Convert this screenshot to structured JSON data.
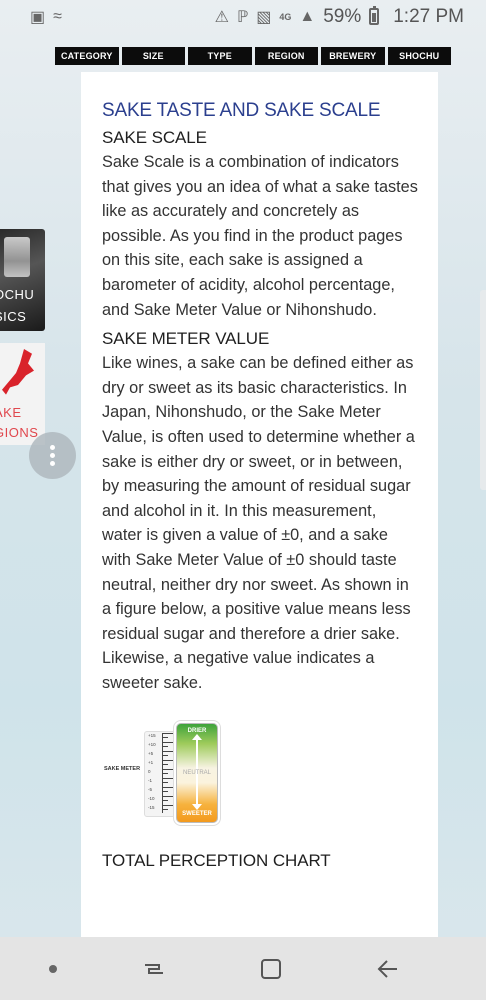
{
  "status_bar": {
    "battery_percent": "59%",
    "time": "1:27 PM",
    "network": "4G"
  },
  "nav": {
    "tabs": [
      {
        "label": "CATEGORY"
      },
      {
        "label": "SIZE"
      },
      {
        "label": "TYPE"
      },
      {
        "label": "REGION"
      },
      {
        "label": "BREWERY"
      },
      {
        "label": "SHOCHU"
      }
    ]
  },
  "side": {
    "thumb1_text": [
      "OCHU",
      "SICS"
    ],
    "thumb2_text": [
      "AKE",
      "GIONS"
    ]
  },
  "article": {
    "title": "SAKE TASTE AND SAKE SCALE",
    "sections": [
      {
        "heading": "SAKE SCALE",
        "body": "Sake Scale is a combination of indicators that gives you an idea of what a sake tastes like as accurately and concretely as possible. As you find in the product pages on this site, each sake is assigned a barometer of acidity, alcohol percentage, and Sake Meter Value or Nihonshudo."
      },
      {
        "heading": "SAKE METER VALUE",
        "body": "Like wines, a sake can be defined either as dry or sweet as its basic characteristics. In Japan, Nihonshudo, or the Sake Meter Value, is often used to determine whether a sake is either dry or sweet, or in between, by measuring the amount of residual sugar and alcohol in it. In this measurement, water is given a value of ±0, and a sake with Sake Meter Value of ±0 should taste neutral, neither dry nor sweet. As shown in a figure below, a positive value means less residual sugar and therefore a drier sake. Likewise, a negative value indicates a sweeter sake."
      }
    ],
    "figure": {
      "label": "SAKE METER",
      "ticks": [
        "+15",
        "+10",
        "+5",
        "+1",
        "0",
        "-1",
        "-5",
        "-10",
        "-15"
      ],
      "top": "DRIER",
      "middle": "NEUTRAL",
      "bottom": "SWEETER"
    },
    "next_heading": "TOTAL PERCEPTION CHART"
  }
}
